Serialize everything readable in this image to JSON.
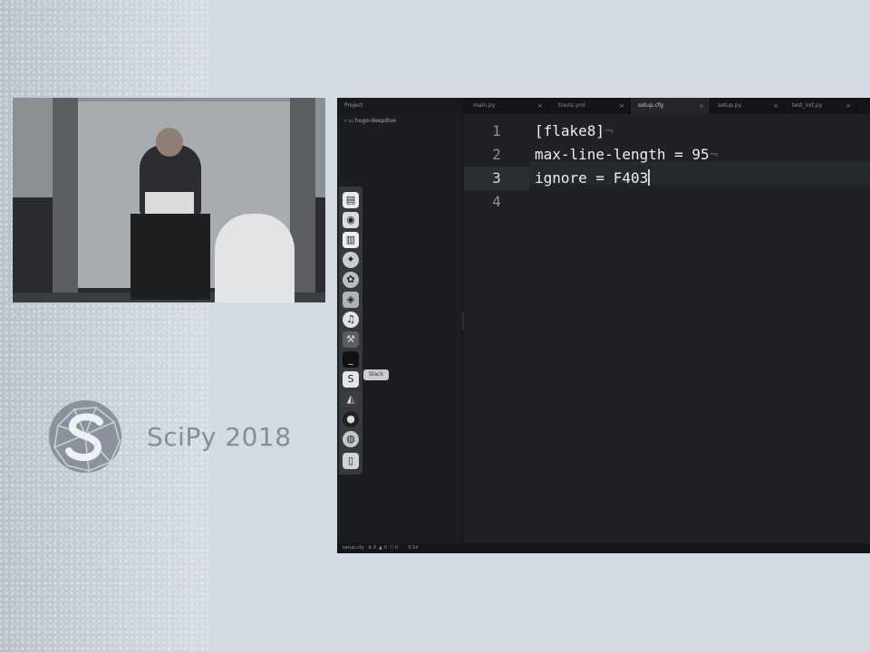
{
  "branding": {
    "logo_icon": "scipy-logo-icon",
    "logo_text": "SciPy 2018"
  },
  "video": {
    "icon": "speaker-video-feed"
  },
  "editor": {
    "project_label": "Project",
    "tree_root": "hugo-deepdive",
    "tabs": [
      {
        "label": "main.py",
        "active": false
      },
      {
        "label": "travis.yml",
        "active": false
      },
      {
        "label": "setup.cfg",
        "active": true
      },
      {
        "label": "setup.py",
        "active": false
      },
      {
        "label": "test_init.py",
        "active": false
      }
    ],
    "line_numbers": [
      "1",
      "2",
      "3",
      "4"
    ],
    "active_line": 3,
    "code_lines": [
      "[flake8]",
      "max-line-length = 95",
      "ignore = F403",
      ""
    ],
    "status": {
      "file": "setup.cfg",
      "errors": "0",
      "warnings": "0",
      "info": "0",
      "position": "3:14"
    }
  },
  "dock": {
    "tooltip": "Slack",
    "icons": [
      "finder-icon",
      "preview-icon",
      "notes-icon",
      "safari-icon",
      "photos-icon",
      "virtualbox-icon",
      "music-icon",
      "dev-tool-icon",
      "terminal-icon",
      "slack-icon",
      "activity-monitor-icon",
      "app-icon",
      "globe-icon",
      "trash-icon"
    ]
  }
}
